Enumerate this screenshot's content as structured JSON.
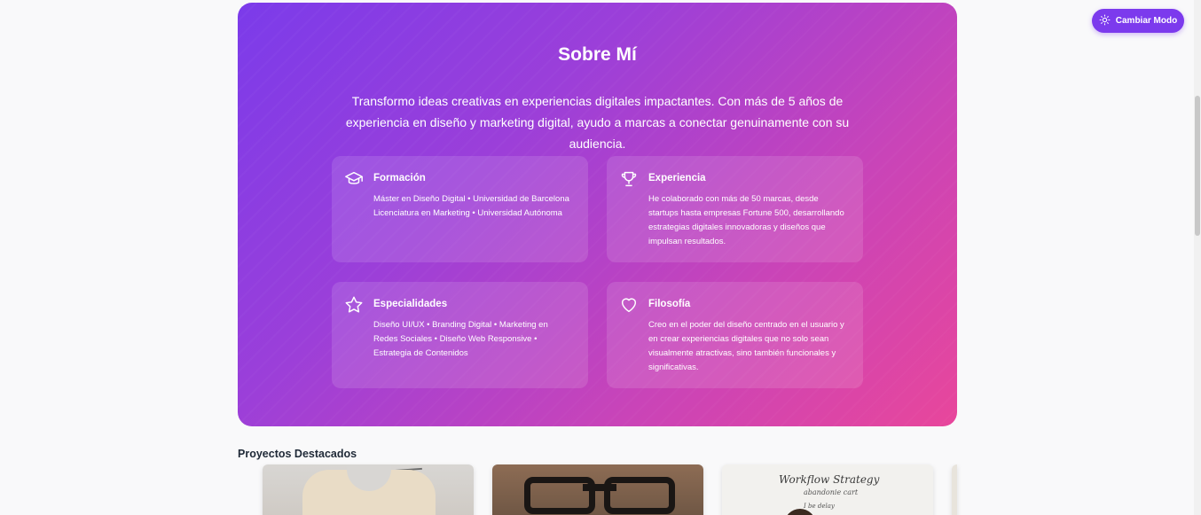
{
  "header": {
    "mode_button_label": "Cambiar Modo",
    "mode_button_icon": "sun-icon"
  },
  "about": {
    "title": "Sobre Mí",
    "intro": "Transformo ideas creativas en experiencias digitales impactantes. Con más de 5 años de experiencia en diseño y marketing digital, ayudo a marcas a conectar genuinamente con su audiencia.",
    "cards": [
      {
        "icon": "graduation-cap-icon",
        "title": "Formación",
        "body": "Máster en Diseño Digital • Universidad de Barcelona\nLicenciatura en Marketing • Universidad Autónoma"
      },
      {
        "icon": "trophy-icon",
        "title": "Experiencia",
        "body": "He colaborado con más de 50 marcas, desde startups hasta empresas Fortune 500, desarrollando estrategias digitales innovadoras y diseños que impulsan resultados."
      },
      {
        "icon": "star-icon",
        "title": "Especialidades",
        "body": "Diseño UI/UX • Branding Digital • Marketing en Redes Sociales • Diseño Web Responsive • Estrategia de Contenidos"
      },
      {
        "icon": "heart-icon",
        "title": "Filosofía",
        "body": "Creo en el poder del diseño centrado en el usuario y en crear experiencias digitales que no solo sean visualmente atractivas, sino también funcionales y significativas."
      }
    ]
  },
  "projects": {
    "title": "Proyectos Destacados",
    "thumbnail_text": {
      "workflow_heading": "Workflow Strategy",
      "workflow_line1": "abandonie cart",
      "workflow_line2": "I be delay"
    }
  },
  "colors": {
    "accent": "#7c3aed",
    "gradient_start": "#7b3bea",
    "gradient_end": "#e8469b"
  }
}
